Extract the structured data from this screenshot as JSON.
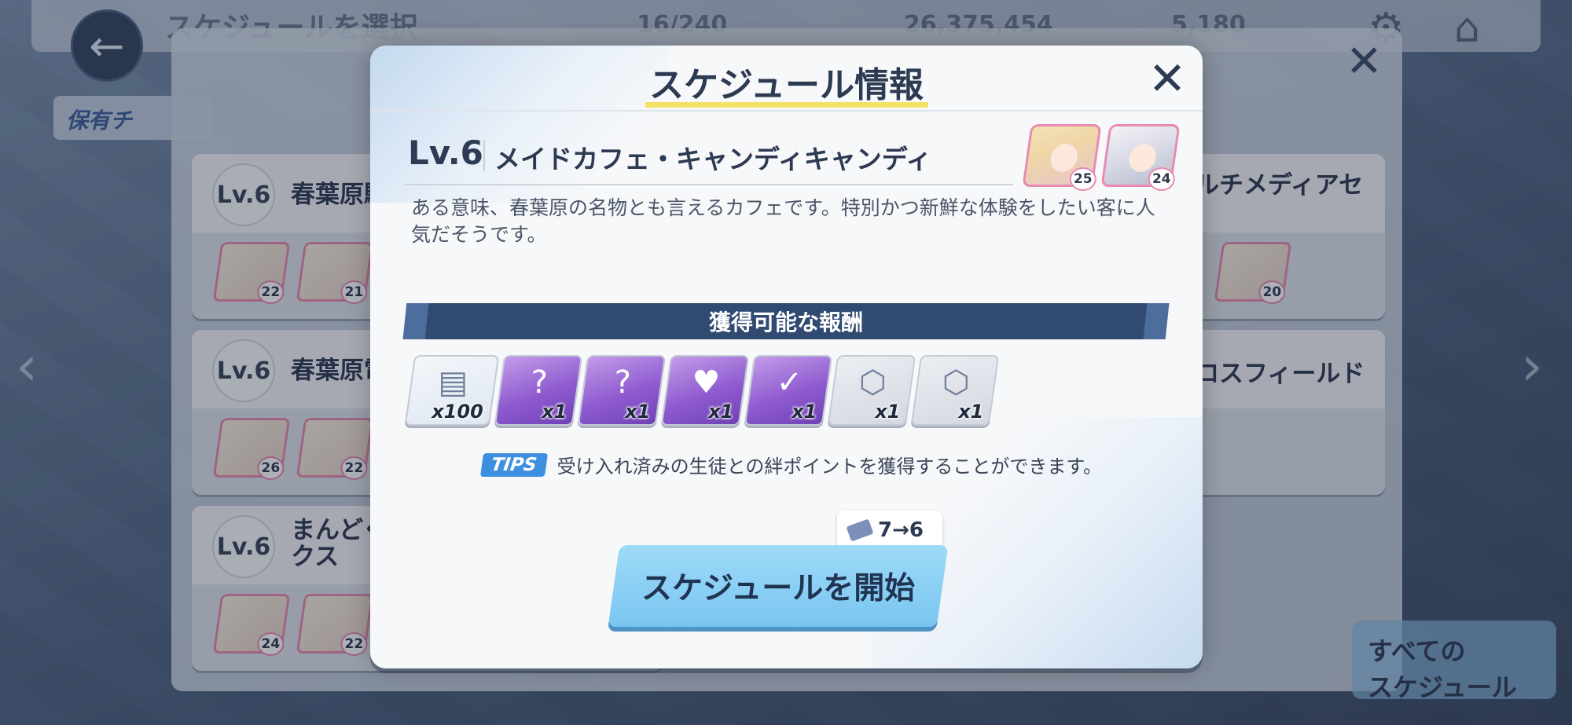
{
  "background": {
    "top_title": "スケジュールを選択",
    "resources": {
      "ticket": "16/240",
      "credits": "26,375,454",
      "pyroxene": "5,180"
    },
    "owned_tab": "保有チ",
    "rows_left": [
      {
        "level": "Lv.6",
        "name": "春葉原駅",
        "chars": [
          "22",
          "21"
        ]
      },
      {
        "level": "Lv.6",
        "name": "春葉原電",
        "chars": [
          "26",
          "22"
        ]
      },
      {
        "level": "Lv.6",
        "name": "まんどく\nクス",
        "chars": [
          "24",
          "22"
        ]
      }
    ],
    "rows_right": [
      {
        "name": "ルチメディアセ",
        "chars": [
          "20"
        ]
      },
      {
        "name": "ロスフィールド"
      }
    ],
    "all_schedule": "すべての\nスケジュール"
  },
  "modal": {
    "title": "スケジュール情報",
    "level": "Lv.6",
    "place_name": "メイドカフェ・キャンディキャンディ",
    "characters": [
      {
        "bond": "25"
      },
      {
        "bond": "24"
      }
    ],
    "description": "ある意味、春葉原の名物とも言えるカフェです。特別かつ新鮮な体験をしたい客に人気だそうです。",
    "reward_title": "獲得可能な報酬",
    "rewards": [
      {
        "icon": "exp-report-icon",
        "qty": "x100",
        "style": "exp"
      },
      {
        "icon": "mystery-gift-box-icon",
        "qty": "x1",
        "style": "purple"
      },
      {
        "icon": "mystery-gift-book-icon",
        "qty": "x1",
        "style": "purple"
      },
      {
        "icon": "ex-gift-box-icon",
        "qty": "x1",
        "style": "purple"
      },
      {
        "icon": "gift-book-icon",
        "qty": "x1",
        "style": "purple"
      },
      {
        "icon": "student-token-icon",
        "qty": "x1",
        "style": "grey"
      },
      {
        "icon": "student-token-icon",
        "qty": "x1",
        "style": "grey"
      }
    ],
    "tips_badge": "TIPS",
    "tips_text": "受け入れ済みの生徒との絆ポイントを獲得することができます。",
    "cost": "7→6",
    "start_label": "スケジュールを開始"
  },
  "colors": {
    "accent_blue": "#79c5f1",
    "banner_navy": "#304a72",
    "title_underline": "#f3e266",
    "portrait_pink": "#e98bb1"
  }
}
